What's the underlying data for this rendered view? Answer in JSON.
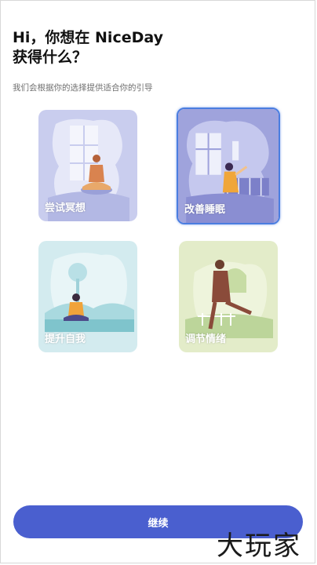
{
  "header": {
    "title_line1": "Hi，你想在 NiceDay",
    "title_line2": "获得什么？",
    "subtitle": "我们会根据你的选择提供适合你的引导"
  },
  "options": [
    {
      "label": "尝试冥想",
      "icon": "meditation-illustration",
      "selected": false,
      "color": "#c9cdee"
    },
    {
      "label": "改善睡眠",
      "icon": "sleep-illustration",
      "selected": true,
      "color": "#9fa3dc"
    },
    {
      "label": "提升自我",
      "icon": "self-improvement-illustration",
      "selected": false,
      "color": "#d3ebef"
    },
    {
      "label": "调节情绪",
      "icon": "mood-illustration",
      "selected": false,
      "color": "#e3ecc9"
    }
  ],
  "continue_label": "继续",
  "watermark": "大玩家",
  "colors": {
    "accent": "#4a5fcf",
    "selected_border": "#4a7de0"
  }
}
